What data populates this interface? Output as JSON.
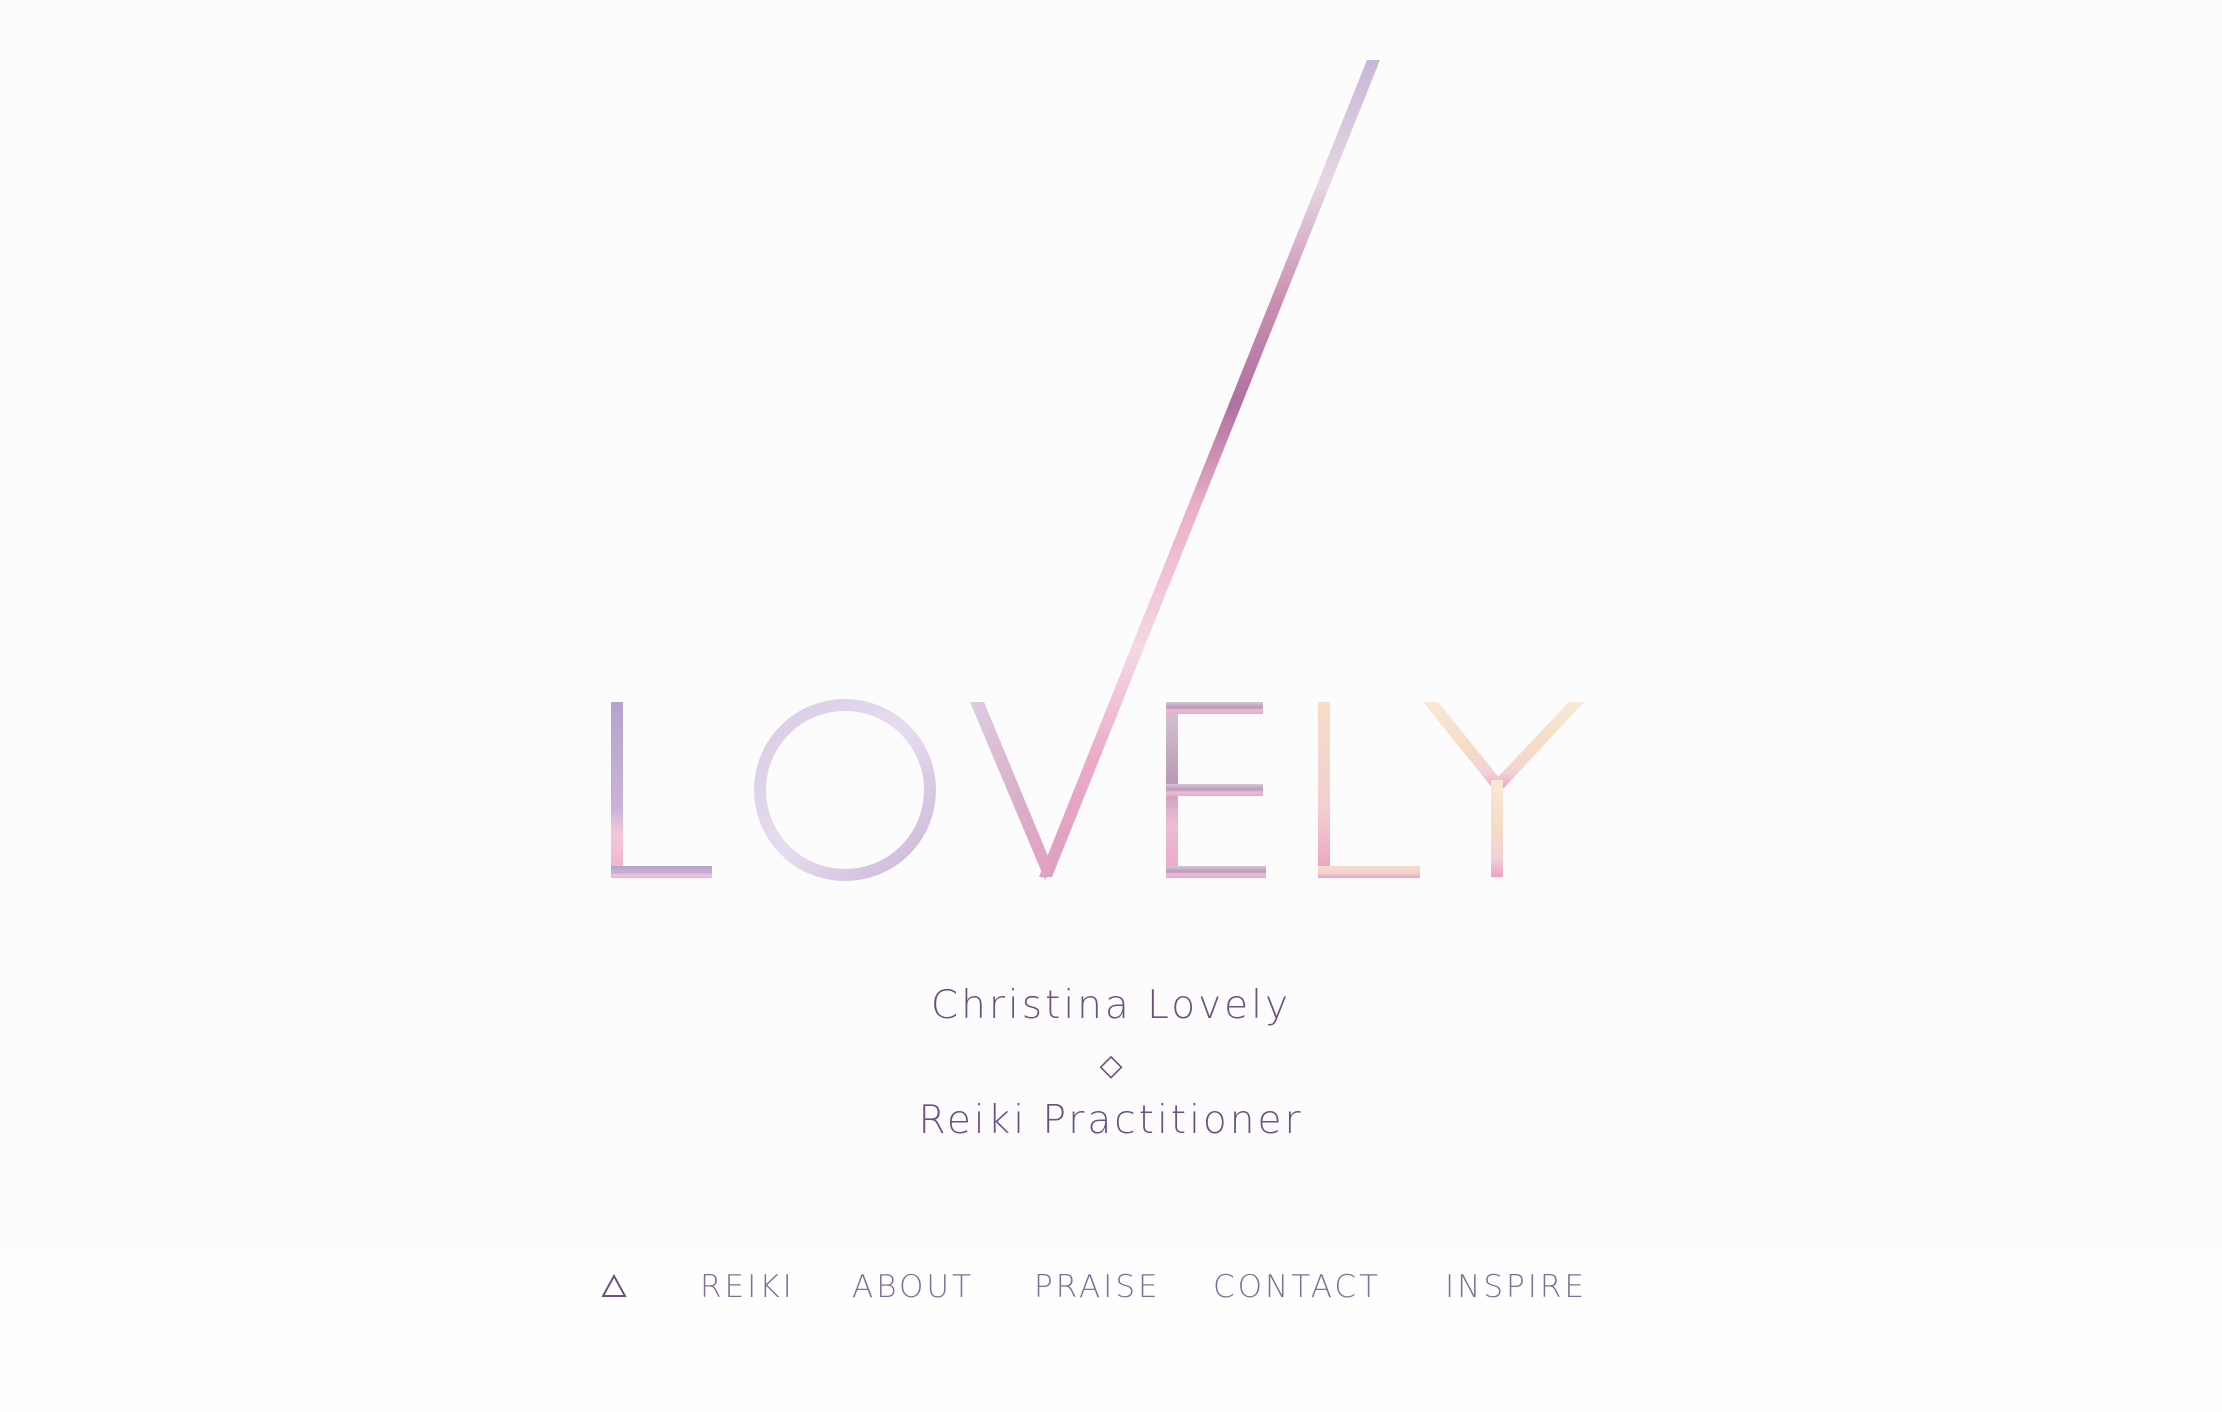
{
  "logo": {
    "wordmark": "LOVELY",
    "colors": {
      "lavender": "#b9a7cf",
      "lilac": "#d9c9e3",
      "pink": "#ec9fbf",
      "mauve": "#b77aa3",
      "peach": "#f7dcc0"
    }
  },
  "tagline": {
    "name": "Christina Lovely",
    "divider": "◇",
    "title": "Reiki Practitioner"
  },
  "nav": {
    "home_icon": "triangle-outline-icon",
    "items": [
      {
        "label": "REIKI"
      },
      {
        "label": "ABOUT"
      },
      {
        "label": "PRAISE"
      },
      {
        "label": "CONTACT"
      },
      {
        "label": "INSPIRE"
      }
    ]
  },
  "colors": {
    "text": "#6b5182",
    "nav_text": "#7d6f97",
    "background": "#fefefe"
  }
}
